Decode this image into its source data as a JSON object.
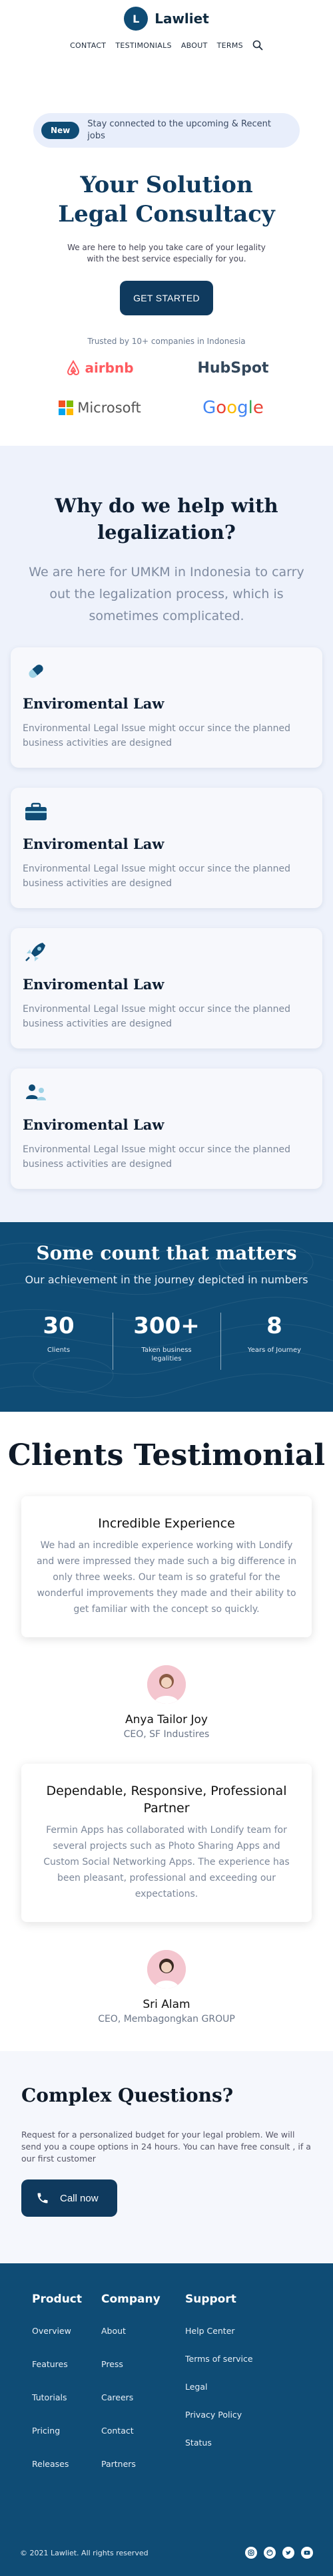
{
  "brand": {
    "initial": "L",
    "name": "Lawliet"
  },
  "nav": {
    "items": [
      "CONTACT",
      "TESTIMONIALS",
      "ABOUT",
      "TERMS"
    ]
  },
  "hero": {
    "badge": "New",
    "announcement": "Stay connected to the upcoming & Recent jobs",
    "title_line1": "Your Solution",
    "title_line2": "Legal Consultacy",
    "subtitle": "We are here to help you take care of your legality with the best service especially for you.",
    "cta": "GET STARTED",
    "trusted": "Trusted by 10+ companies in Indonesia",
    "logos": [
      "airbnb",
      "HubSpot",
      "Microsoft",
      "Google"
    ]
  },
  "why": {
    "title": "Why do we help with legalization?",
    "lead": "We are here for UMKM in Indonesia to carry out the legalization process, which is sometimes complicated.",
    "cards": [
      {
        "icon": "pill-icon",
        "title": "Enviromental Law",
        "text": "Environmental Legal Issue might occur since the planned business activities are designed"
      },
      {
        "icon": "briefcase-icon",
        "title": "Enviromental Law",
        "text": "Environmental Legal Issue might occur since the planned business activities are designed"
      },
      {
        "icon": "rocket-icon",
        "title": "Enviromental Law",
        "text": "Environmental Legal Issue might occur since the planned business activities are designed"
      },
      {
        "icon": "people-icon",
        "title": "Enviromental Law",
        "text": "Environmental Legal Issue might occur since the planned business activities are designed"
      }
    ]
  },
  "counts": {
    "title": "Some count that matters",
    "caption": "Our achievement in the journey depicted in numbers",
    "stats": [
      {
        "num": "30",
        "label": "Clients"
      },
      {
        "num": "300+",
        "label": "Taken business legalities"
      },
      {
        "num": "8",
        "label": "Years of Journey"
      }
    ]
  },
  "testimonials": {
    "title": "Clients Testimonial",
    "items": [
      {
        "heading": "Incredible Experience",
        "quote": "We had an incredible experience working with Londify and were impressed they made such a big difference in only three weeks. Our team is so grateful for the wonderful improvements they made and their ability to get familiar with the concept so quickly.",
        "name": "Anya Tailor Joy",
        "role": "CEO, SF Industires"
      },
      {
        "heading": "Dependable, Responsive, Professional Partner",
        "quote": "Fermin Apps has collaborated with Londify team for several projects such as Photo Sharing Apps and Custom Social Networking Apps. The experience has been pleasant, professional and exceeding our expectations.",
        "name": "Sri Alam",
        "role": "CEO, Membagongkan GROUP"
      }
    ]
  },
  "questions": {
    "title": "Complex Questions?",
    "text": "Request for a personalized budget for your legal problem. We will send you a coupe options in 24 hours. You can have free consult , if a our first customer",
    "cta": "Call now"
  },
  "footer": {
    "columns": [
      {
        "title": "Product",
        "links": [
          "Overview",
          "Features",
          "Tutorials",
          "Pricing",
          "Releases"
        ]
      },
      {
        "title": "Company",
        "links": [
          "About",
          "Press",
          "Careers",
          "Contact",
          "Partners"
        ]
      },
      {
        "title": "Support",
        "links": [
          "Help Center",
          "Terms of service",
          "Legal",
          "Privacy Policy",
          "Status"
        ]
      }
    ],
    "copyright": "© 2021 Lawliet. All rights reserved",
    "socials": [
      "instagram-icon",
      "dribbble-icon",
      "twitter-icon",
      "youtube-icon"
    ]
  },
  "colors": {
    "primary": "#0f4c75",
    "dark": "#0f3a5e",
    "section_bg": "#eef2fb"
  }
}
